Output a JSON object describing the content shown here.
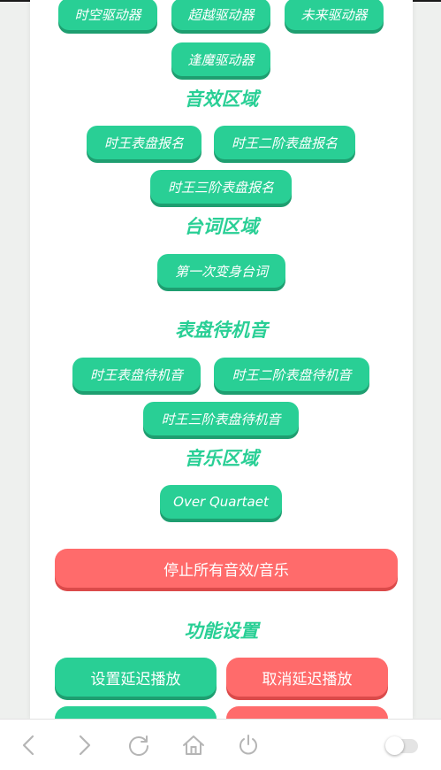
{
  "drivers": {
    "b1": "时空驱动器",
    "b2": "超越驱动器",
    "b3": "未来驱动器",
    "b4": "逢魔驱动器"
  },
  "sfx": {
    "heading": "音效区域",
    "b1": "时王表盘报名",
    "b2": "时王二阶表盘报名",
    "b3": "时王三阶表盘报名"
  },
  "lines": {
    "heading": "台词区域",
    "b1": "第一次变身台词"
  },
  "standby": {
    "heading": "表盘待机音",
    "b1": "时王表盘待机音",
    "b2": "时王二阶表盘待机音",
    "b3": "时王三阶表盘待机音"
  },
  "music": {
    "heading": "音乐区域",
    "b1": "Over Quartaet"
  },
  "stop_all": "停止所有音效/音乐",
  "settings": {
    "heading": "功能设置",
    "set_delay": "设置延迟播放",
    "cancel_delay": "取消延迟播放"
  },
  "nav": {
    "toggle_on": false
  },
  "colors": {
    "green": "#29cf95",
    "red": "#ff6b6b"
  }
}
